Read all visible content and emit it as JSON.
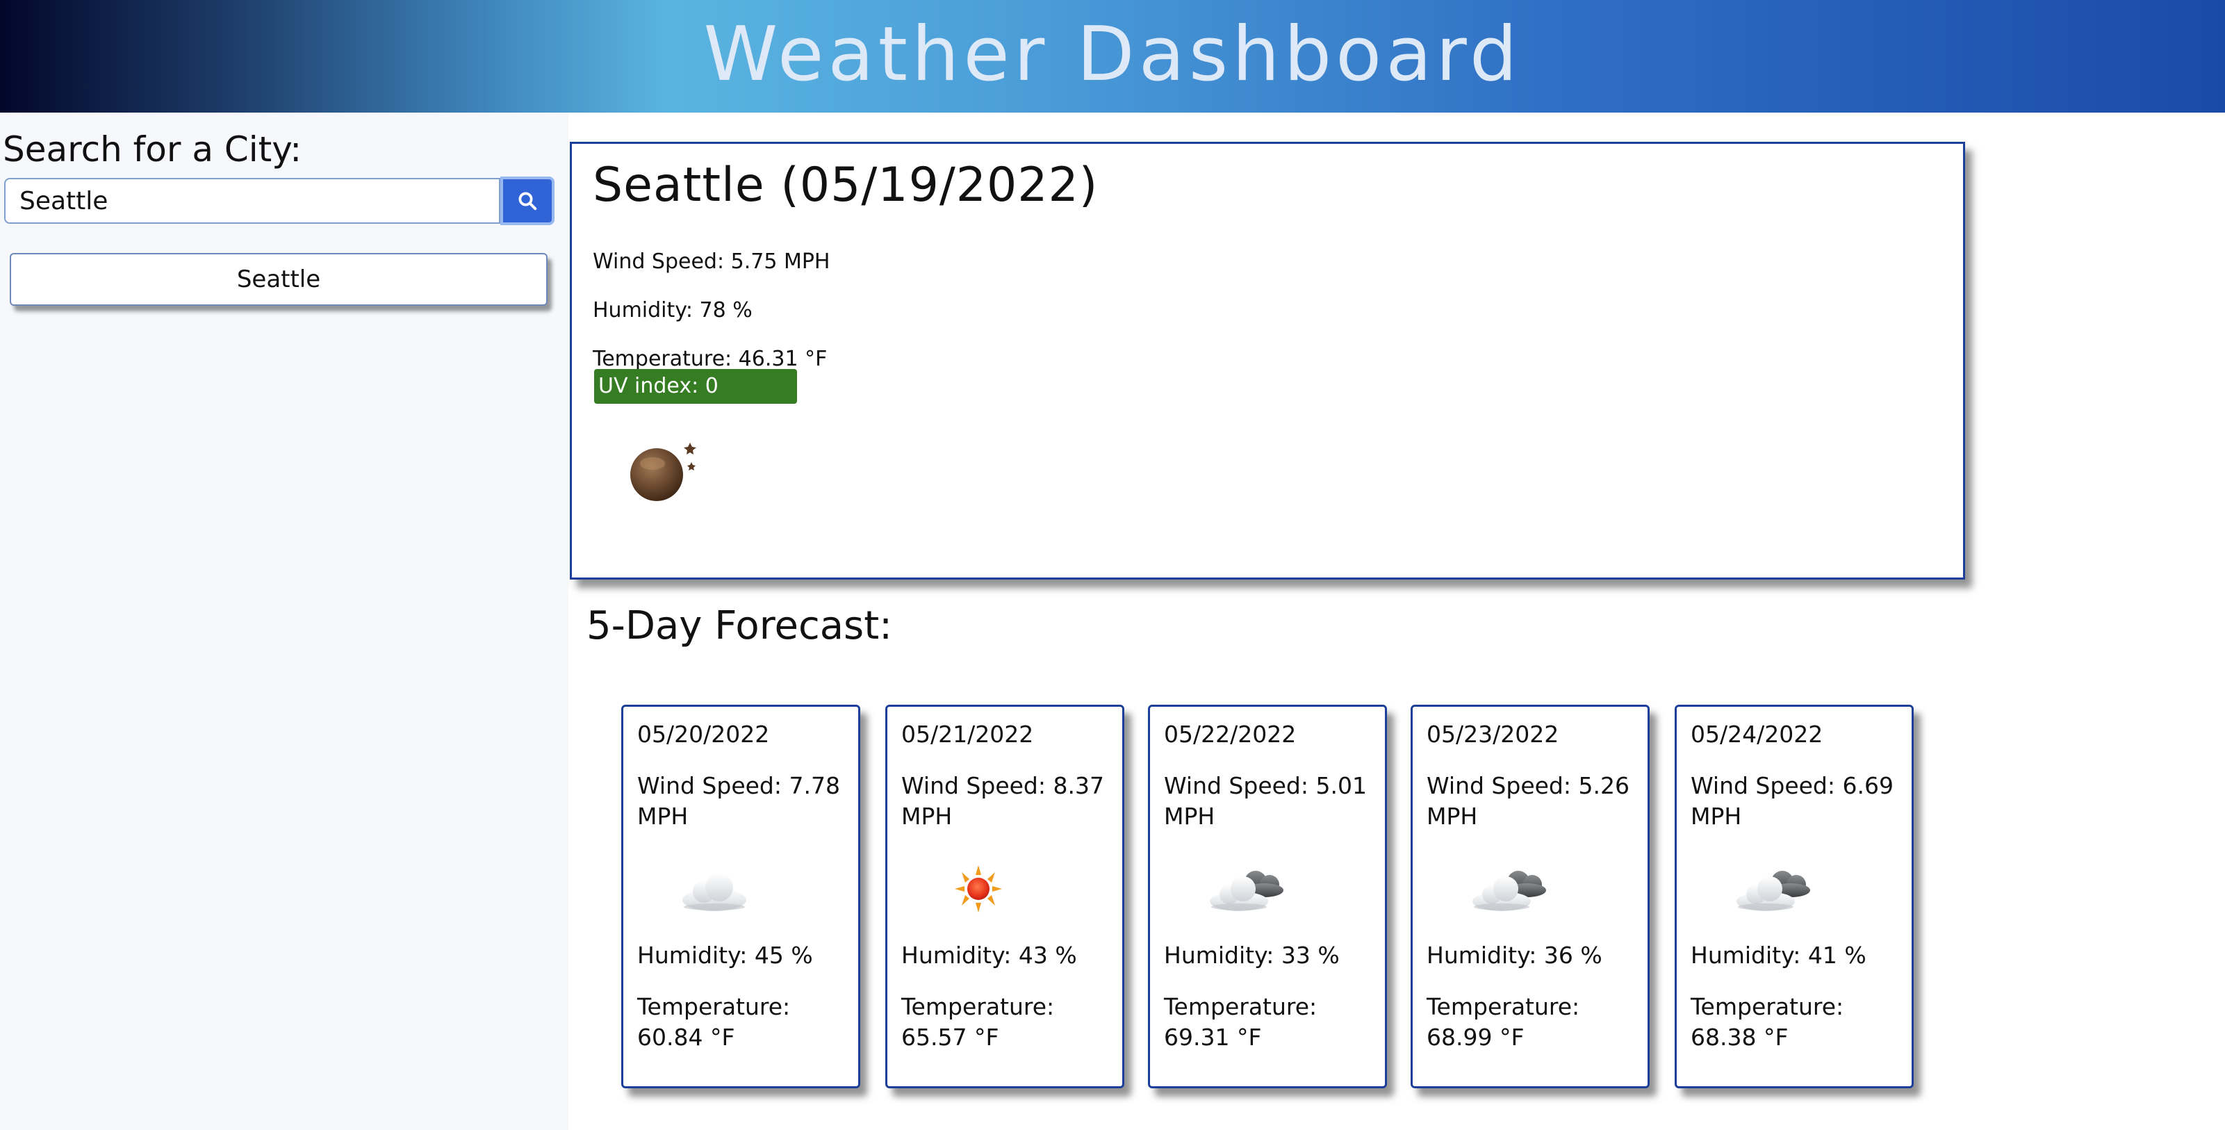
{
  "header": {
    "title": "Weather Dashboard"
  },
  "sidebar": {
    "search_label": "Search for a City:",
    "search_value": "Seattle",
    "search_icon": "search-icon",
    "history": [
      "Seattle"
    ]
  },
  "current": {
    "title": "Seattle (05/19/2022)",
    "wind": "Wind Speed: 5.75 MPH",
    "humidity": "Humidity: 78 %",
    "temperature": "Temperature: 46.31 °F",
    "uv": "UV index: 0",
    "uv_color": "#357c22",
    "icon": "night-clear-icon"
  },
  "forecast": {
    "title": "5-Day Forecast:",
    "days": [
      {
        "date": "05/20/2022",
        "wind": "Wind Speed: 7.78 MPH",
        "icon": "cloud-icon",
        "humidity": "Humidity: 45 %",
        "temperature": "Temperature: 60.84 °F"
      },
      {
        "date": "05/21/2022",
        "wind": "Wind Speed: 8.37 MPH",
        "icon": "sun-icon",
        "humidity": "Humidity: 43 %",
        "temperature": "Temperature: 65.57 °F"
      },
      {
        "date": "05/22/2022",
        "wind": "Wind Speed: 5.01 MPH",
        "icon": "broken-clouds-icon",
        "humidity": "Humidity: 33 %",
        "temperature": "Temperature: 69.31 °F"
      },
      {
        "date": "05/23/2022",
        "wind": "Wind Speed: 5.26 MPH",
        "icon": "broken-clouds-icon",
        "humidity": "Humidity: 36 %",
        "temperature": "Temperature: 68.99 °F"
      },
      {
        "date": "05/24/2022",
        "wind": "Wind Speed: 6.69 MPH",
        "icon": "broken-clouds-icon",
        "humidity": "Humidity: 41 %",
        "temperature": "Temperature: 68.38 °F"
      }
    ]
  },
  "colors": {
    "accent": "#2f63d6",
    "card_border": "#1d3f99"
  }
}
